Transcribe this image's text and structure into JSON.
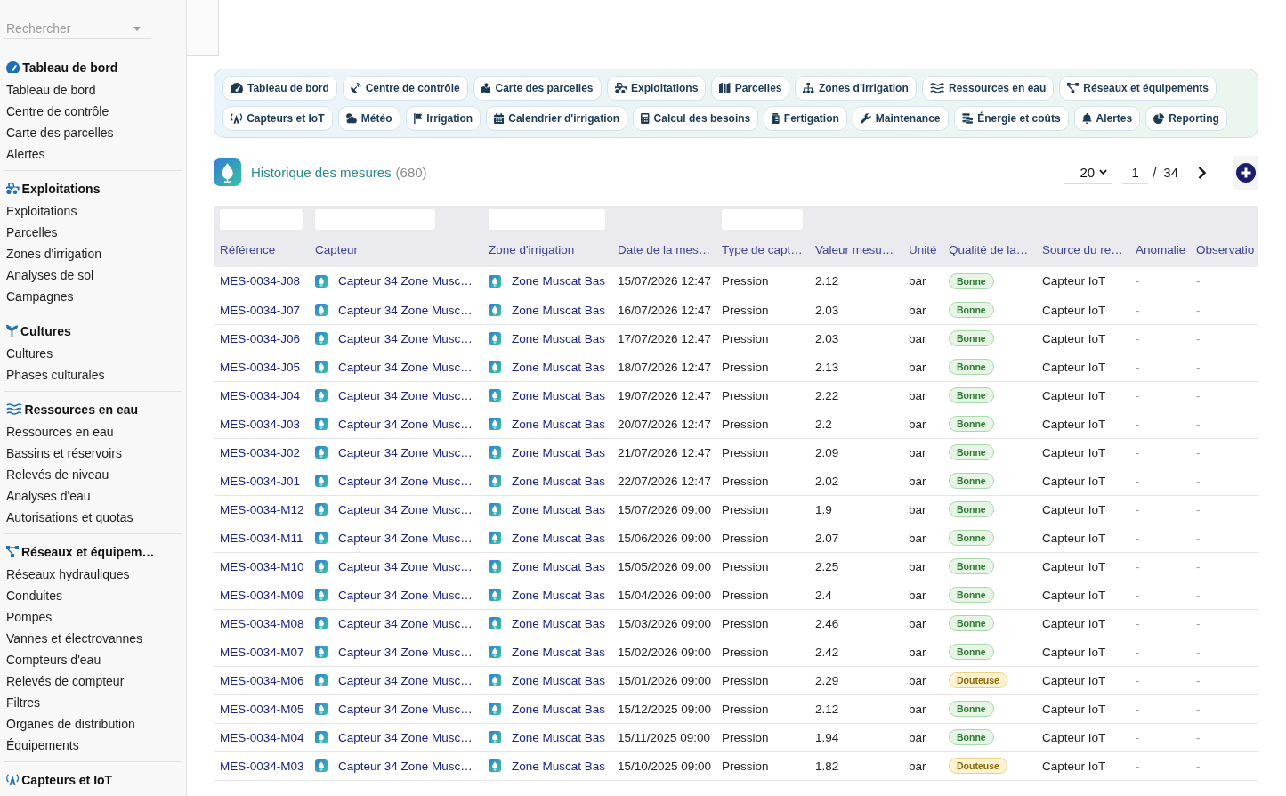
{
  "sidebar": {
    "search": {
      "placeholder": "Rechercher"
    },
    "sections": [
      {
        "heading": "Tableau de bord",
        "items": [
          "Tableau de bord",
          "Centre de contrôle",
          "Carte des parcelles",
          "Alertes"
        ]
      },
      {
        "heading": "Exploitations",
        "items": [
          "Exploitations",
          "Parcelles",
          "Zones d'irrigation",
          "Analyses de sol",
          "Campagnes"
        ]
      },
      {
        "heading": "Cultures",
        "items": [
          "Cultures",
          "Phases culturales"
        ]
      },
      {
        "heading": "Ressources en eau",
        "items": [
          "Ressources en eau",
          "Bassins et réservoirs",
          "Relevés de niveau",
          "Analyses d'eau",
          "Autorisations et quotas"
        ]
      },
      {
        "heading": "Réseaux et équipem…",
        "items": [
          "Réseaux hydrauliques",
          "Conduites",
          "Pompes",
          "Vannes et électrovannes",
          "Compteurs d'eau",
          "Relevés de compteur",
          "Filtres",
          "Organes de distribution",
          "Équipements"
        ]
      },
      {
        "heading": "Capteurs et IoT"
      }
    ]
  },
  "quick_links": [
    [
      "Tableau de bord",
      "Centre de contrôle",
      "Carte des parcelles",
      "Exploitations",
      "Parcelles",
      "Zones d'irrigation",
      "Ressources en eau",
      "Réseaux et équipements"
    ],
    [
      "Capteurs et IoT",
      "Météo",
      "Irrigation",
      "Calendrier d'irrigation",
      "Calcul des besoins",
      "Fertigation",
      "Maintenance",
      "Énergie et coûts",
      "Alertes",
      "Reporting"
    ]
  ],
  "list_header": {
    "title": "Historique des mesures",
    "count": "(680)",
    "page_size": "20",
    "page": "1",
    "separator": "/",
    "page_count": "34"
  },
  "table": {
    "columns": [
      {
        "label": "Référence",
        "filter": true
      },
      {
        "label": "Capteur",
        "filter": true
      },
      {
        "label": "Zone d'irrigation",
        "filter": true
      },
      {
        "label": "Date de la mes…",
        "filter": false
      },
      {
        "label": "Type de capt…",
        "filter": true
      },
      {
        "label": "Valeur mesu…",
        "filter": false
      },
      {
        "label": "Unité",
        "filter": false
      },
      {
        "label": "Qualité de la…",
        "filter": false
      },
      {
        "label": "Source du re…",
        "filter": false
      },
      {
        "label": "Anomalie",
        "filter": false
      },
      {
        "label": "Observatio",
        "filter": false
      }
    ],
    "rows": [
      {
        "reference": "MES-0034-J08",
        "sensor": "Capteur 34 Zone Musc…",
        "zone": "Zone Muscat Bas",
        "date": "15/07/2026 12:47",
        "type": "Pression",
        "value": "2.12",
        "unit": "bar",
        "quality": {
          "label": "Bonne",
          "kind": "good"
        },
        "source": "Capteur IoT",
        "anomaly": "-",
        "observation": "-"
      },
      {
        "reference": "MES-0034-J07",
        "sensor": "Capteur 34 Zone Musc…",
        "zone": "Zone Muscat Bas",
        "date": "16/07/2026 12:47",
        "type": "Pression",
        "value": "2.03",
        "unit": "bar",
        "quality": {
          "label": "Bonne",
          "kind": "good"
        },
        "source": "Capteur IoT",
        "anomaly": "-",
        "observation": "-"
      },
      {
        "reference": "MES-0034-J06",
        "sensor": "Capteur 34 Zone Musc…",
        "zone": "Zone Muscat Bas",
        "date": "17/07/2026 12:47",
        "type": "Pression",
        "value": "2.03",
        "unit": "bar",
        "quality": {
          "label": "Bonne",
          "kind": "good"
        },
        "source": "Capteur IoT",
        "anomaly": "-",
        "observation": "-"
      },
      {
        "reference": "MES-0034-J05",
        "sensor": "Capteur 34 Zone Musc…",
        "zone": "Zone Muscat Bas",
        "date": "18/07/2026 12:47",
        "type": "Pression",
        "value": "2.13",
        "unit": "bar",
        "quality": {
          "label": "Bonne",
          "kind": "good"
        },
        "source": "Capteur IoT",
        "anomaly": "-",
        "observation": "-"
      },
      {
        "reference": "MES-0034-J04",
        "sensor": "Capteur 34 Zone Musc…",
        "zone": "Zone Muscat Bas",
        "date": "19/07/2026 12:47",
        "type": "Pression",
        "value": "2.22",
        "unit": "bar",
        "quality": {
          "label": "Bonne",
          "kind": "good"
        },
        "source": "Capteur IoT",
        "anomaly": "-",
        "observation": "-"
      },
      {
        "reference": "MES-0034-J03",
        "sensor": "Capteur 34 Zone Musc…",
        "zone": "Zone Muscat Bas",
        "date": "20/07/2026 12:47",
        "type": "Pression",
        "value": "2.2",
        "unit": "bar",
        "quality": {
          "label": "Bonne",
          "kind": "good"
        },
        "source": "Capteur IoT",
        "anomaly": "-",
        "observation": "-"
      },
      {
        "reference": "MES-0034-J02",
        "sensor": "Capteur 34 Zone Musc…",
        "zone": "Zone Muscat Bas",
        "date": "21/07/2026 12:47",
        "type": "Pression",
        "value": "2.09",
        "unit": "bar",
        "quality": {
          "label": "Bonne",
          "kind": "good"
        },
        "source": "Capteur IoT",
        "anomaly": "-",
        "observation": "-"
      },
      {
        "reference": "MES-0034-J01",
        "sensor": "Capteur 34 Zone Musc…",
        "zone": "Zone Muscat Bas",
        "date": "22/07/2026 12:47",
        "type": "Pression",
        "value": "2.02",
        "unit": "bar",
        "quality": {
          "label": "Bonne",
          "kind": "good"
        },
        "source": "Capteur IoT",
        "anomaly": "-",
        "observation": "-"
      },
      {
        "reference": "MES-0034-M12",
        "sensor": "Capteur 34 Zone Musc…",
        "zone": "Zone Muscat Bas",
        "date": "15/07/2026 09:00",
        "type": "Pression",
        "value": "1.9",
        "unit": "bar",
        "quality": {
          "label": "Bonne",
          "kind": "good"
        },
        "source": "Capteur IoT",
        "anomaly": "-",
        "observation": "-"
      },
      {
        "reference": "MES-0034-M11",
        "sensor": "Capteur 34 Zone Musc…",
        "zone": "Zone Muscat Bas",
        "date": "15/06/2026 09:00",
        "type": "Pression",
        "value": "2.07",
        "unit": "bar",
        "quality": {
          "label": "Bonne",
          "kind": "good"
        },
        "source": "Capteur IoT",
        "anomaly": "-",
        "observation": "-"
      },
      {
        "reference": "MES-0034-M10",
        "sensor": "Capteur 34 Zone Musc…",
        "zone": "Zone Muscat Bas",
        "date": "15/05/2026 09:00",
        "type": "Pression",
        "value": "2.25",
        "unit": "bar",
        "quality": {
          "label": "Bonne",
          "kind": "good"
        },
        "source": "Capteur IoT",
        "anomaly": "-",
        "observation": "-"
      },
      {
        "reference": "MES-0034-M09",
        "sensor": "Capteur 34 Zone Musc…",
        "zone": "Zone Muscat Bas",
        "date": "15/04/2026 09:00",
        "type": "Pression",
        "value": "2.4",
        "unit": "bar",
        "quality": {
          "label": "Bonne",
          "kind": "good"
        },
        "source": "Capteur IoT",
        "anomaly": "-",
        "observation": "-"
      },
      {
        "reference": "MES-0034-M08",
        "sensor": "Capteur 34 Zone Musc…",
        "zone": "Zone Muscat Bas",
        "date": "15/03/2026 09:00",
        "type": "Pression",
        "value": "2.46",
        "unit": "bar",
        "quality": {
          "label": "Bonne",
          "kind": "good"
        },
        "source": "Capteur IoT",
        "anomaly": "-",
        "observation": "-"
      },
      {
        "reference": "MES-0034-M07",
        "sensor": "Capteur 34 Zone Musc…",
        "zone": "Zone Muscat Bas",
        "date": "15/02/2026 09:00",
        "type": "Pression",
        "value": "2.42",
        "unit": "bar",
        "quality": {
          "label": "Bonne",
          "kind": "good"
        },
        "source": "Capteur IoT",
        "anomaly": "-",
        "observation": "-"
      },
      {
        "reference": "MES-0034-M06",
        "sensor": "Capteur 34 Zone Musc…",
        "zone": "Zone Muscat Bas",
        "date": "15/01/2026 09:00",
        "type": "Pression",
        "value": "2.29",
        "unit": "bar",
        "quality": {
          "label": "Douteuse",
          "kind": "doubtful"
        },
        "source": "Capteur IoT",
        "anomaly": "-",
        "observation": "-"
      },
      {
        "reference": "MES-0034-M05",
        "sensor": "Capteur 34 Zone Musc…",
        "zone": "Zone Muscat Bas",
        "date": "15/12/2025 09:00",
        "type": "Pression",
        "value": "2.12",
        "unit": "bar",
        "quality": {
          "label": "Bonne",
          "kind": "good"
        },
        "source": "Capteur IoT",
        "anomaly": "-",
        "observation": "-"
      },
      {
        "reference": "MES-0034-M04",
        "sensor": "Capteur 34 Zone Musc…",
        "zone": "Zone Muscat Bas",
        "date": "15/11/2025 09:00",
        "type": "Pression",
        "value": "1.94",
        "unit": "bar",
        "quality": {
          "label": "Bonne",
          "kind": "good"
        },
        "source": "Capteur IoT",
        "anomaly": "-",
        "observation": "-"
      },
      {
        "reference": "MES-0034-M03",
        "sensor": "Capteur 34 Zone Musc…",
        "zone": "Zone Muscat Bas",
        "date": "15/10/2025 09:00",
        "type": "Pression",
        "value": "1.82",
        "unit": "bar",
        "quality": {
          "label": "Douteuse",
          "kind": "doubtful"
        },
        "source": "Capteur IoT",
        "anomaly": "-",
        "observation": "-"
      }
    ]
  }
}
